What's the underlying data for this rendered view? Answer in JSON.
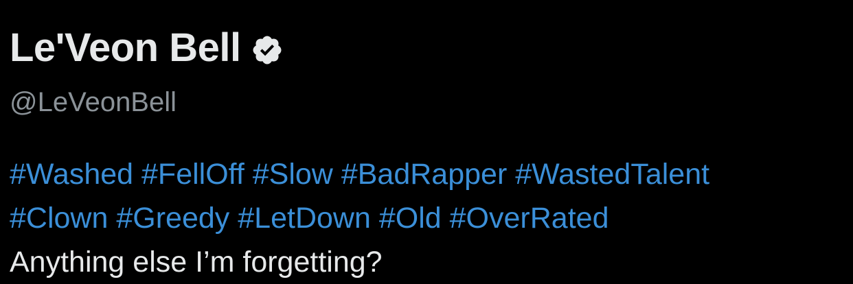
{
  "profile": {
    "display_name": "Le'Veon Bell",
    "handle": "@LeVeonBell",
    "verified_icon": "verified-badge-icon"
  },
  "tweet": {
    "hashtags_line1": [
      "#Washed",
      "#FellOff",
      "#Slow",
      "#BadRapper",
      "#WastedTalent"
    ],
    "hashtags_line2": [
      "#Clown",
      "#Greedy",
      "#LetDown",
      "#Old",
      "#OverRated"
    ],
    "text": "Anything else I’m forgetting?"
  },
  "colors": {
    "background": "#000000",
    "name": "#e7e9ea",
    "handle": "#8b9298",
    "hashtag": "#3b8fd8",
    "body_text": "#e7e9ea"
  }
}
